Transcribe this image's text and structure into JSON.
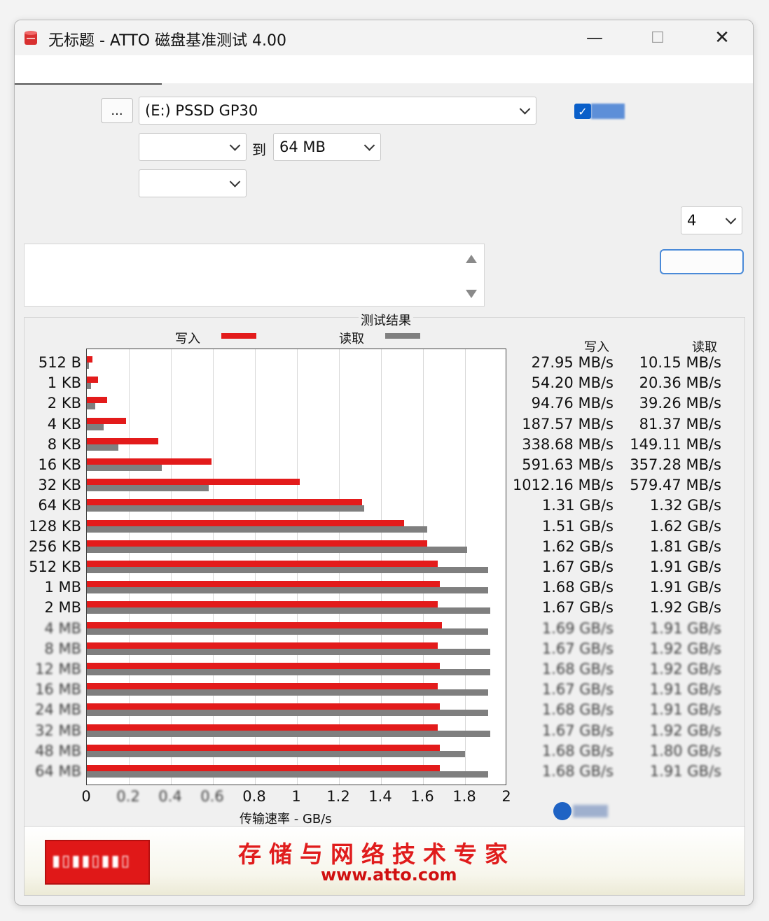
{
  "window": {
    "title": "无标题 - ATTO 磁盘基准测试 4.00",
    "controls": {
      "minimize": "—",
      "maximize": "☐",
      "close": "✕"
    }
  },
  "settings": {
    "browse_label": "...",
    "drive": "(E:) PSSD GP30",
    "io_size_from": "",
    "to_label": "到",
    "io_size_to": "64 MB",
    "file_size": "",
    "queue_depth": "4",
    "checkbox_checked": true
  },
  "results": {
    "title": "测试结果",
    "legend_write": "写入",
    "legend_read": "读取",
    "col_write": "写入",
    "col_read": "读取",
    "write_color": "#e31b1b",
    "read_color": "#7f7f7f",
    "rows": [
      {
        "label": "512 B",
        "write": "27.95 MB/s",
        "read": "10.15 MB/s"
      },
      {
        "label": "1 KB",
        "write": "54.20 MB/s",
        "read": "20.36 MB/s"
      },
      {
        "label": "2 KB",
        "write": "94.76 MB/s",
        "read": "39.26 MB/s"
      },
      {
        "label": "4 KB",
        "write": "187.57 MB/s",
        "read": "81.37 MB/s"
      },
      {
        "label": "8 KB",
        "write": "338.68 MB/s",
        "read": "149.11 MB/s"
      },
      {
        "label": "16 KB",
        "write": "591.63 MB/s",
        "read": "357.28 MB/s"
      },
      {
        "label": "32 KB",
        "write": "1012.16 MB/s",
        "read": "579.47 MB/s"
      },
      {
        "label": "64 KB",
        "write": "1.31 GB/s",
        "read": "1.32 GB/s"
      },
      {
        "label": "128 KB",
        "write": "1.51 GB/s",
        "read": "1.62 GB/s"
      },
      {
        "label": "256 KB",
        "write": "1.62 GB/s",
        "read": "1.81 GB/s"
      },
      {
        "label": "512 KB",
        "write": "1.67 GB/s",
        "read": "1.91 GB/s"
      },
      {
        "label": "1 MB",
        "write": "1.68 GB/s",
        "read": "1.91 GB/s"
      },
      {
        "label": "2 MB",
        "write": "1.67 GB/s",
        "read": "1.92 GB/s"
      }
    ]
  },
  "chart_data": {
    "type": "bar",
    "orientation": "horizontal",
    "title": "测试结果",
    "xlabel": "传输速率 - GB/s",
    "xlim": [
      0,
      2
    ],
    "x_ticks": [
      "0",
      "0.2",
      "0.4",
      "0.6",
      "0.8",
      "1",
      "1.2",
      "1.4",
      "1.6",
      "1.8",
      "2"
    ],
    "categories": [
      "512 B",
      "1 KB",
      "2 KB",
      "4 KB",
      "8 KB",
      "16 KB",
      "32 KB",
      "64 KB",
      "128 KB",
      "256 KB",
      "512 KB",
      "1 MB",
      "2 MB",
      "4 MB",
      "8 MB",
      "12 MB",
      "16 MB",
      "24 MB",
      "32 MB",
      "48 MB",
      "64 MB"
    ],
    "series": [
      {
        "name": "写入",
        "values": [
          0.028,
          0.054,
          0.095,
          0.188,
          0.339,
          0.592,
          1.012,
          1.31,
          1.51,
          1.62,
          1.67,
          1.68,
          1.67,
          1.69,
          1.67,
          1.68,
          1.67,
          1.68,
          1.67,
          1.68,
          1.68
        ]
      },
      {
        "name": "读取",
        "values": [
          0.01,
          0.02,
          0.039,
          0.081,
          0.149,
          0.357,
          0.579,
          1.32,
          1.62,
          1.81,
          1.91,
          1.91,
          1.92,
          1.91,
          1.92,
          1.92,
          1.91,
          1.91,
          1.92,
          1.8,
          1.91
        ]
      }
    ],
    "grid": true,
    "legend": "top"
  },
  "banner": {
    "slogan": "存储与网络技术专家",
    "url": "www.atto.com"
  },
  "icons": {
    "app": "disk-icon",
    "check": "✓"
  }
}
